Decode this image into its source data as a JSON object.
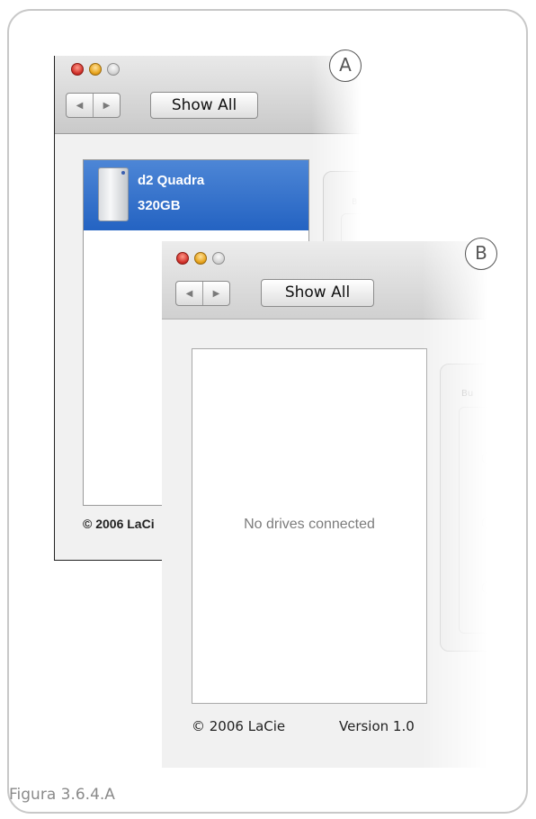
{
  "figure": {
    "caption": "Figura 3.6.4.A"
  },
  "callouts": {
    "a": "A",
    "b": "B"
  },
  "window_a": {
    "show_all_label": "Show All",
    "drive_name": "d2 Quadra",
    "drive_size": "320GB",
    "copyright": "© 2006 LaCi",
    "group_label": "B"
  },
  "window_b": {
    "show_all_label": "Show All",
    "empty_message": "No drives connected",
    "copyright": "© 2006 LaCie",
    "version": "Version 1.0",
    "group_label": "Bu"
  },
  "icons": [
    "close-light",
    "minimize-light",
    "zoom-light",
    "back-arrow-icon",
    "forward-arrow-icon",
    "hard-drive-icon"
  ],
  "colors": {
    "selection": "#2f6ccc",
    "caption": "#8a8a8a",
    "frame_border": "#c8c8c8"
  }
}
